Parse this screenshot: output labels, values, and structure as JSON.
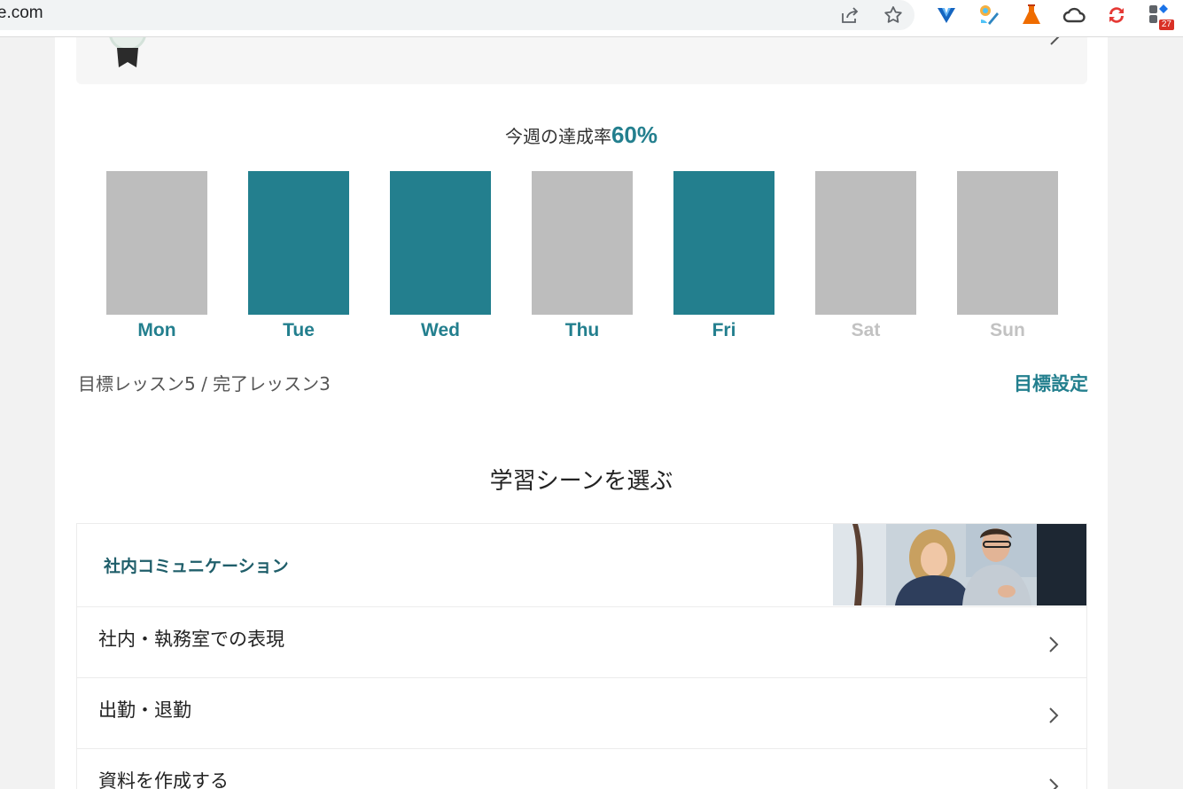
{
  "browser": {
    "url_fragment": "ore.com",
    "extension_badge": "27"
  },
  "award": {},
  "weekly": {
    "title_prefix": "今週の達成率",
    "rate": "60%",
    "days": [
      {
        "label": "Mon",
        "done": false,
        "active": true
      },
      {
        "label": "Tue",
        "done": true,
        "active": true
      },
      {
        "label": "Wed",
        "done": true,
        "active": true
      },
      {
        "label": "Thu",
        "done": false,
        "active": true
      },
      {
        "label": "Fri",
        "done": true,
        "active": true
      },
      {
        "label": "Sat",
        "done": false,
        "active": false
      },
      {
        "label": "Sun",
        "done": false,
        "active": false
      }
    ],
    "goal_summary": "目標レッスン5 / 完了レッスン3",
    "goal_setting_link": "目標設定"
  },
  "colors": {
    "accent": "#237f8e",
    "bar_done": "#237f8e",
    "bar_pending": "#bdbdbd",
    "label_inactive": "#c2c2c2"
  },
  "scenes": {
    "section_title": "学習シーンを選ぶ",
    "category_label": "社内コミュニケーション",
    "items": [
      {
        "label": "社内・執務室での表現"
      },
      {
        "label": "出勤・退勤"
      },
      {
        "label": "資料を作成する"
      }
    ]
  }
}
